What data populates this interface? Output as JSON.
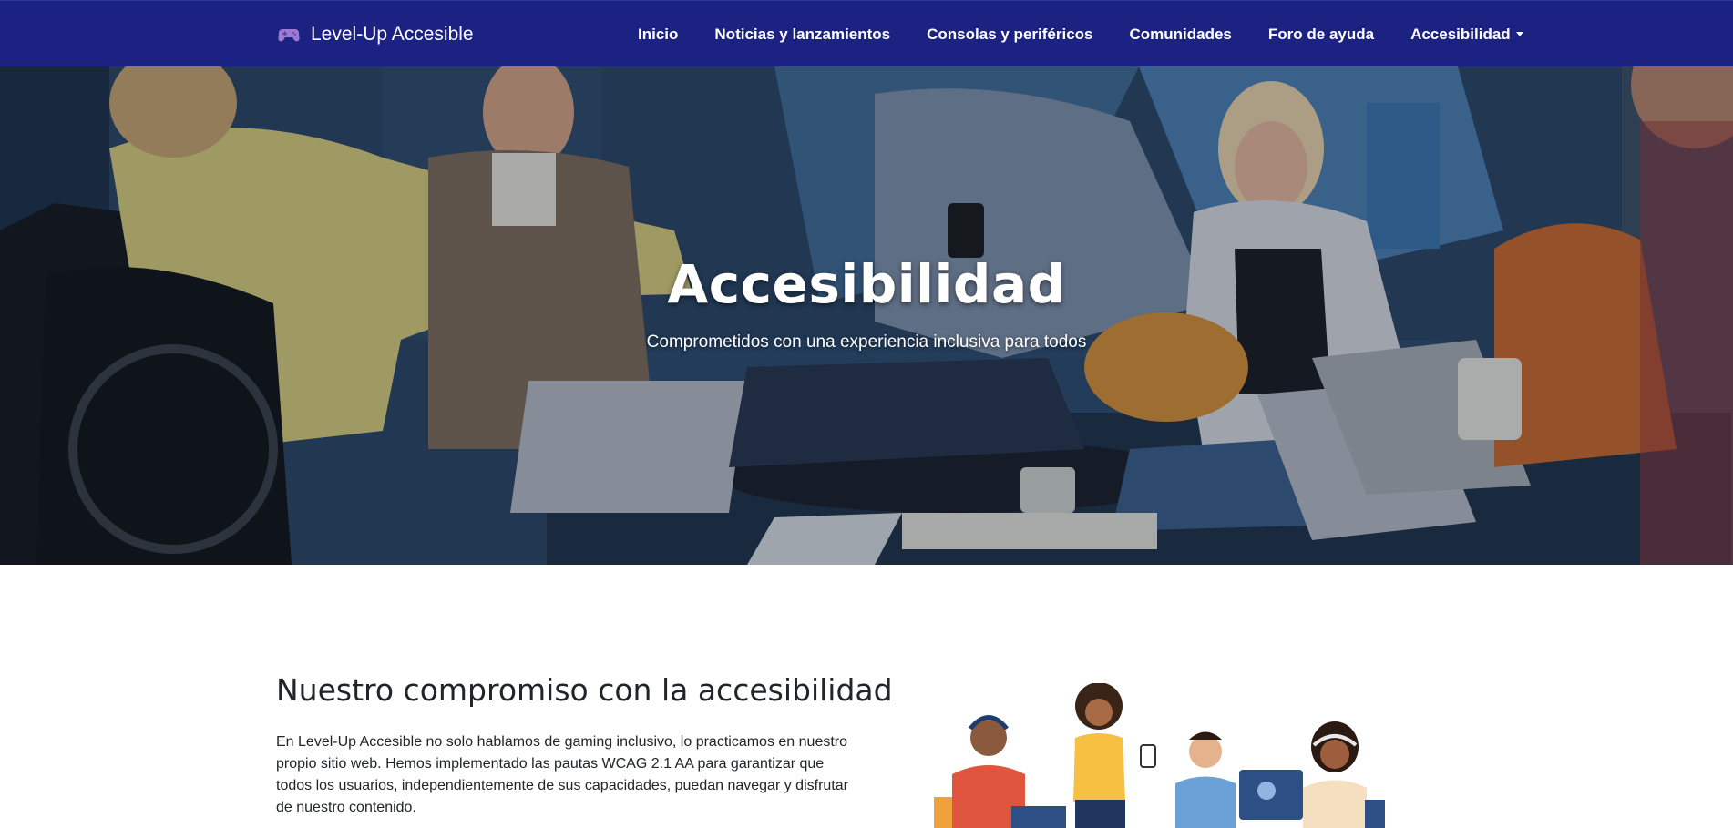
{
  "brand": {
    "name": "Level-Up Accesible",
    "icon": "gamepad-icon"
  },
  "nav": {
    "items": [
      {
        "label": "Inicio"
      },
      {
        "label": "Noticias y lanzamientos"
      },
      {
        "label": "Consolas y periféricos"
      },
      {
        "label": "Comunidades"
      },
      {
        "label": "Foro de ayuda"
      },
      {
        "label": "Accesibilidad",
        "dropdown": true
      }
    ]
  },
  "hero": {
    "title": "Accesibilidad",
    "subtitle": "Comprometidos con una experiencia inclusiva para todos"
  },
  "commitment": {
    "title": "Nuestro compromiso con la accesibilidad",
    "body": "En Level-Up Accesible no solo hablamos de gaming inclusivo, lo practicamos en nuestro propio sitio web. Hemos implementado las pautas WCAG 2.1 AA para garantizar que todos los usuarios, independientemente de sus capacidades, puedan navegar y disfrutar de nuestro contenido."
  },
  "colors": {
    "navbar": "#1b2282",
    "text": "#212529",
    "white": "#ffffff"
  }
}
